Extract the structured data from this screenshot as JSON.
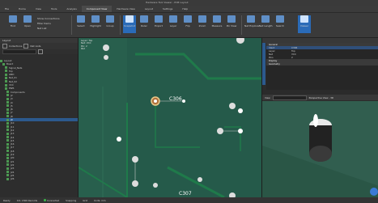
{
  "window": {
    "title": "Hardware Tool Viewer - PCB Layout"
  },
  "ribbon_tabs": [
    "File",
    "Home",
    "View",
    "Tools",
    "Analysis",
    "Component View",
    "Hardware View",
    "Layout",
    "Settings",
    "Help"
  ],
  "ribbon": {
    "buttons": [
      "Find",
      "Open",
      "Select",
      "Highlight",
      "Group",
      "Snapshot",
      "Ruler",
      "Export",
      "Layer",
      "Flip",
      "Zoom",
      "Measure",
      "Pin View",
      "Net Explorer",
      "Net Length",
      "Search",
      "Viewer"
    ],
    "small": [
      "Show Connections",
      "Filter Items",
      "Net List"
    ]
  },
  "left_panel": {
    "title": "Layout",
    "toolbar": [
      "Collections",
      "Net Lists"
    ],
    "tree": [
      "Layout",
      "Board",
      "Signal_Nets",
      "Top",
      "GND",
      "Net_01",
      "Net_02",
      "VCC",
      "PWR",
      "Components",
      "J2",
      "J3",
      "J4",
      "J5",
      "J6",
      "J7",
      "J8",
      "J9",
      "J10",
      "J11",
      "J12",
      "J13",
      "J14",
      "J15",
      "J16",
      "J17",
      "J18",
      "J19",
      "J20",
      "J21",
      "J22",
      "J23",
      "J24",
      "J25",
      "J26"
    ],
    "selected_index": 17
  },
  "canvas": {
    "overlay": [
      "Layer: Top",
      "Net: VCC",
      "Pin: 2",
      "Pad"
    ],
    "ref1": "C306",
    "ref2": "C307"
  },
  "right_panel": {
    "properties": [
      {
        "k": "General",
        "v": ""
      },
      {
        "k": "Ident",
        "v": "C306"
      },
      {
        "k": "Layer",
        "v": "Top"
      },
      {
        "k": "Net",
        "v": "VCC"
      },
      {
        "k": "Pins",
        "v": "2"
      },
      {
        "k": "Display",
        "v": ""
      },
      {
        "k": "Geometry",
        "v": ""
      }
    ],
    "viewer_label": "View",
    "viewer_mode": "Perspective View - 3D"
  },
  "statusbar": [
    "Ready",
    "0.0, 1500 Records",
    "Connected",
    "Snapping",
    "Grid",
    "Units: mm"
  ],
  "colors": {
    "accent": "#2a6bb8",
    "board": "#255a4a",
    "trace": "#1f7a4a"
  }
}
